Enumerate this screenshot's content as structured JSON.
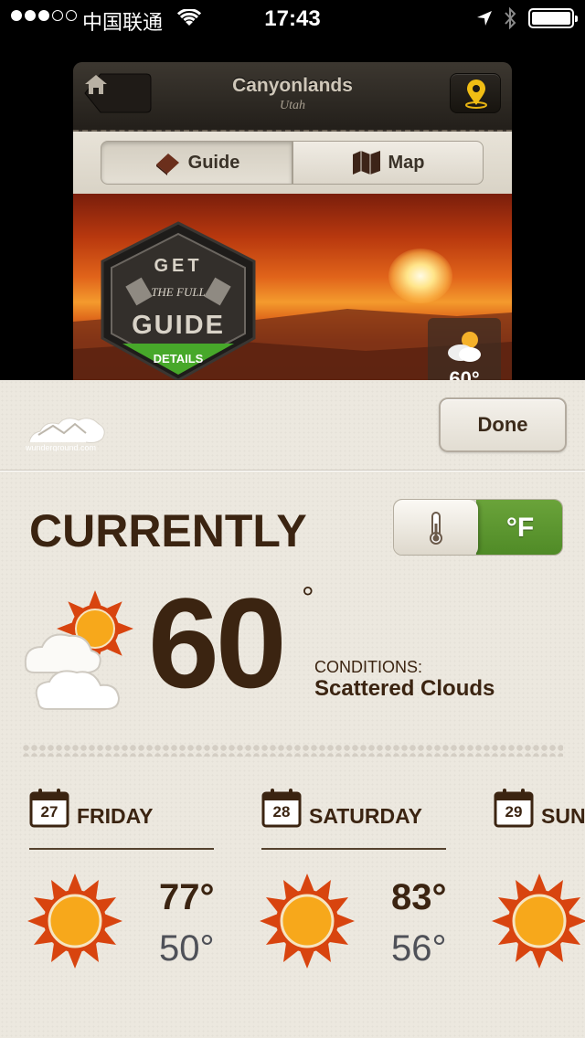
{
  "status_bar": {
    "carrier": "中国联通",
    "time": "17:43"
  },
  "app": {
    "title": "Canyonlands",
    "subtitle": "Utah",
    "tabs": [
      {
        "label": "Guide",
        "selected": true
      },
      {
        "label": "Map",
        "selected": false
      }
    ],
    "badge": {
      "line1": "GET",
      "line2": "THE FULL",
      "line3": "GUIDE",
      "line4": "DETAILS"
    },
    "mini_weather_temp": "60°"
  },
  "weather": {
    "provider_logo_text": "wunderground.com",
    "done_label": "Done",
    "heading": "CURRENTLY",
    "unit_label": "°F",
    "current_temp": "60",
    "degree_symbol": "°",
    "conditions_label": "CONDITIONS:",
    "conditions_value": "Scattered Clouds",
    "forecast": [
      {
        "date": "27",
        "day": "FRIDAY",
        "high": "77°",
        "low": "50°",
        "icon": "sun-icon"
      },
      {
        "date": "28",
        "day": "SATURDAY",
        "high": "83°",
        "low": "56°",
        "icon": "sun-icon"
      },
      {
        "date": "29",
        "day": "SUN",
        "high": "",
        "low": "",
        "icon": "sun-icon"
      }
    ]
  },
  "colors": {
    "brown": "#3b2411",
    "toggle_green": "#5a9430",
    "sun_red": "#d8440f",
    "sun_orange": "#f7a81b"
  }
}
